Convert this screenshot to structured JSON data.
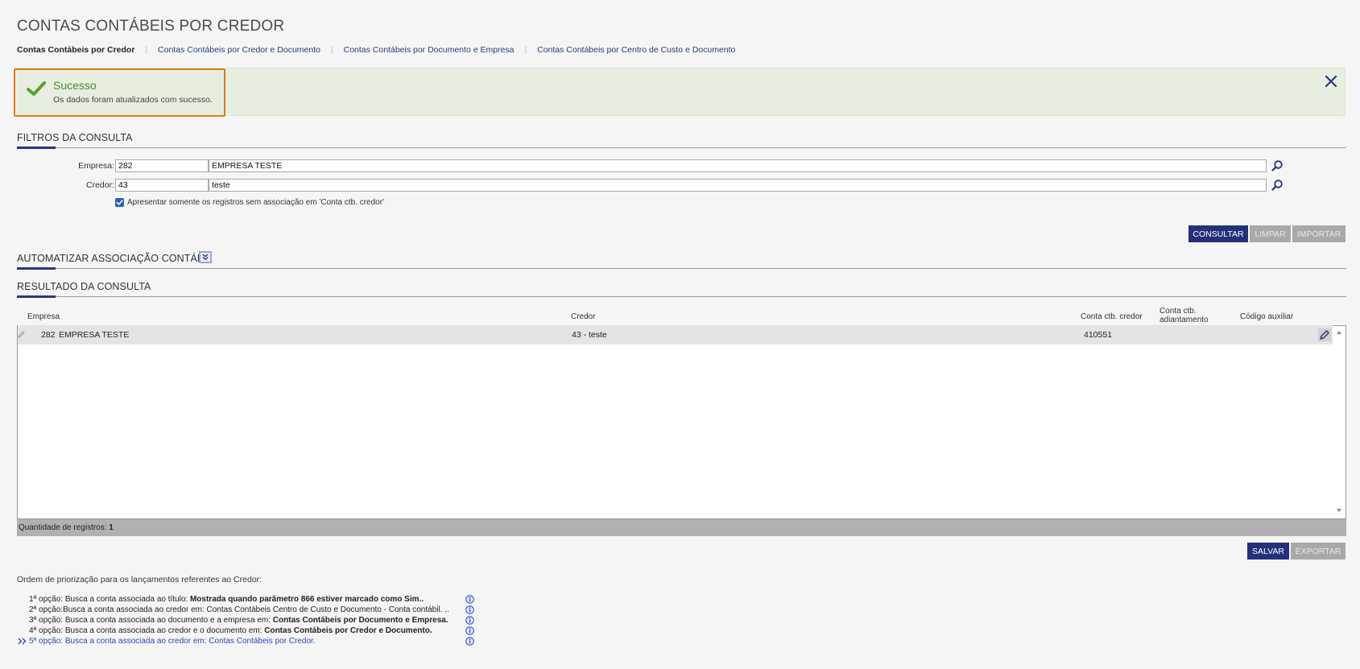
{
  "page": {
    "title": "CONTAS CONTÁBEIS POR CREDOR"
  },
  "tabs": [
    {
      "label": "Contas Contábeis por Credor",
      "active": true
    },
    {
      "label": "Contas Contábeis por Credor e Documento"
    },
    {
      "label": "Contas Contábeis por Documento e Empresa"
    },
    {
      "label": "Contas Contábeis por Centro de Custo e Documento"
    }
  ],
  "alert": {
    "title": "Sucesso",
    "message": "Os dados foram atualizados com sucesso.",
    "icon": "check-icon",
    "color": "#4b8a2b"
  },
  "filters": {
    "section_title": "FILTROS DA CONSULTA",
    "empresa": {
      "label": "Empresa:",
      "code": "282",
      "name": "EMPRESA TESTE"
    },
    "credor": {
      "label": "Credor:",
      "code": "43",
      "name": "teste"
    },
    "checkbox_label": "Apresentar somente os registros sem associação em 'Conta ctb. credor'",
    "checkbox_checked": true
  },
  "buttons": {
    "consultar": "CONSULTAR",
    "limpar": "LIMPAR",
    "importar": "IMPORTAR",
    "salvar": "SALVAR",
    "exportar": "EXPORTAR"
  },
  "automatizar": {
    "section_title": "AUTOMATIZAR ASSOCIAÇÃO CONTÁBIL"
  },
  "results": {
    "section_title": "RESULTADO DA CONSULTA",
    "columns": {
      "empresa": "Empresa",
      "credor": "Credor",
      "conta_credor": "Conta ctb. credor",
      "conta_adiantamento": "Conta ctb. adiantamento",
      "codigo_auxiliar": "Código auxiliar"
    },
    "rows": [
      {
        "empresa_code": "282",
        "empresa_name": "EMPRESA TESTE",
        "credor": "43 - teste",
        "conta_credor": "410551",
        "conta_adiantamento": "",
        "codigo_auxiliar": ""
      }
    ],
    "count_label": "Quantidade de registros:",
    "count_value": "1"
  },
  "priority": {
    "title": "Ordem de priorização para os lançamentos referentes ao Credor:",
    "items": [
      {
        "prefix": "1ª opção:",
        "text": " Busca a conta associada ao título: ",
        "bold": "Mostrada quando parâmetro 866 estiver marcado como Sim..",
        "current": false
      },
      {
        "prefix": "2ª opção:",
        "text": "Busca a conta associada ao credor em: Contas Contábeis Centro de Custo e Documento - Conta contábil. ..",
        "bold": "",
        "current": false
      },
      {
        "prefix": "3ª opção:",
        "text": " Busca a conta associada ao documento e a empresa em: ",
        "bold": "Contas Contábeis por Documento e Empresa.",
        "current": false
      },
      {
        "prefix": "4ª opção:",
        "text": " Busca a conta associada ao credor e o documento em: ",
        "bold": "Contas Contábeis por Credor e Documento.",
        "current": false
      },
      {
        "prefix": "5ª opção:",
        "text": " Busca a conta associada ao credor em: Contas Contábeis por Credor.",
        "bold": "",
        "current": true
      }
    ]
  }
}
